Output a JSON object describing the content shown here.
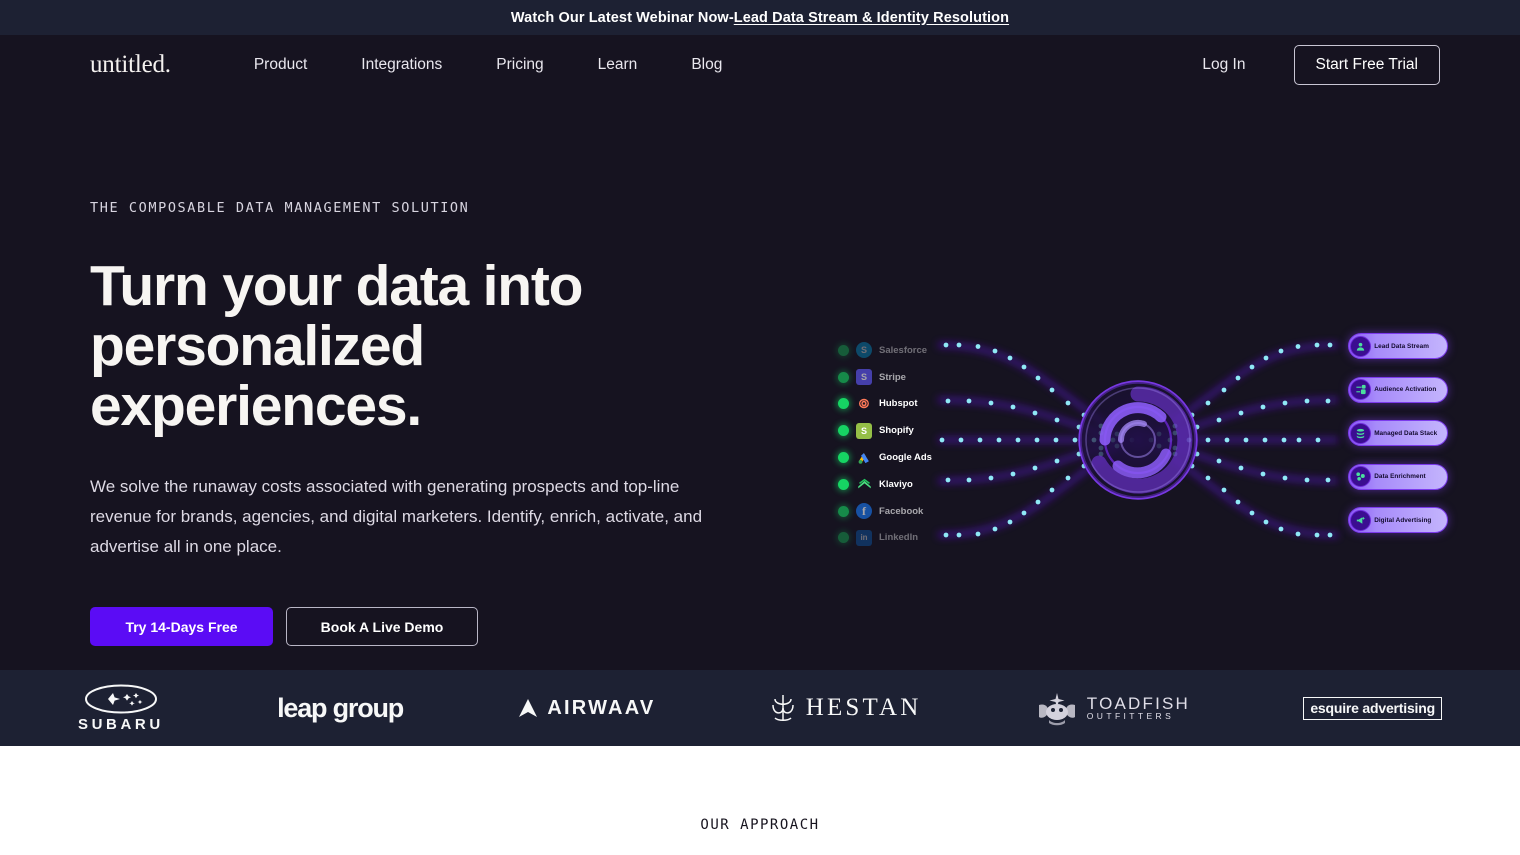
{
  "banner": {
    "prefix": "Watch Our Latest Webinar Now- ",
    "link": "Lead Data Stream & Identity Resolution"
  },
  "nav": {
    "logo": "untitled.",
    "links": [
      {
        "label": "Product"
      },
      {
        "label": "Integrations"
      },
      {
        "label": "Pricing"
      },
      {
        "label": "Learn"
      },
      {
        "label": "Blog"
      }
    ],
    "login": "Log In",
    "trial": "Start Free Trial"
  },
  "hero": {
    "eyebrow": "THE COMPOSABLE DATA MANAGEMENT SOLUTION",
    "headline": "Turn your data into personalized experiences.",
    "subhead": "We solve the runaway costs associated with generating prospects and top-line revenue for brands, agencies, and digital marketers. Identify, enrich, activate, and advertise all in one place.",
    "cta_primary": "Try 14-Days Free",
    "cta_secondary": "Book A Live Demo"
  },
  "illustration": {
    "integrations": [
      {
        "name": "Salesforce",
        "status": "connected"
      },
      {
        "name": "Stripe",
        "status": "connected"
      },
      {
        "name": "Hubspot",
        "status": "connected"
      },
      {
        "name": "Shopify",
        "status": "connected"
      },
      {
        "name": "Google Ads",
        "status": "connected"
      },
      {
        "name": "Klaviyo",
        "status": "connected"
      },
      {
        "name": "Facebook",
        "status": "connected"
      },
      {
        "name": "LinkedIn",
        "status": "connected"
      }
    ],
    "outputs": [
      {
        "label": "Lead Data Stream",
        "icon": "person-icon"
      },
      {
        "label": "Audience Activation",
        "icon": "sliders-icon"
      },
      {
        "label": "Managed Data Stack",
        "icon": "database-icon"
      },
      {
        "label": "Data Enrichment",
        "icon": "nodes-icon"
      },
      {
        "label": "Digital Advertising",
        "icon": "megaphone-icon"
      }
    ],
    "colors": {
      "accent": "#5b0cf5",
      "node_dot": "#7fe8f5",
      "status_dot": "#16d463",
      "ring": "#7c3aed"
    }
  },
  "logos": [
    {
      "name": "SUBARU"
    },
    {
      "name": "leap group"
    },
    {
      "name": "AIRWAAV"
    },
    {
      "name": "HESTAN"
    },
    {
      "name": "TOADFISH",
      "sub": "OUTFITTERS"
    },
    {
      "name": "esquire advertising"
    }
  ],
  "approach": {
    "label": "OUR  APPROACH"
  }
}
